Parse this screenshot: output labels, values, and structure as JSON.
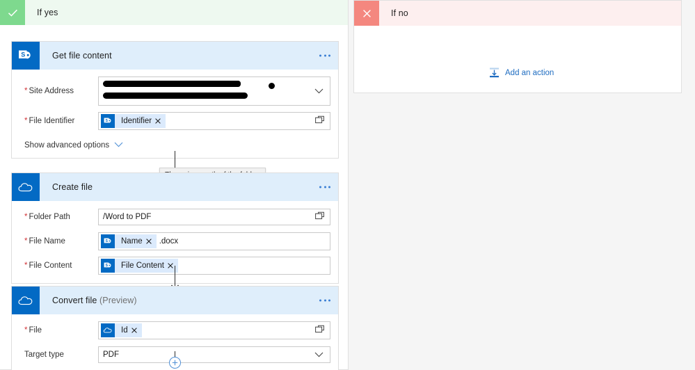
{
  "branches": {
    "yes": {
      "title": "If yes",
      "badge_icon": "checkmark-icon",
      "badge_color": "#7ed98e",
      "header_bg": "#eef9f0"
    },
    "no": {
      "title": "If no",
      "badge_icon": "close-x-icon",
      "badge_color": "#f4877f",
      "header_bg": "#fdefef",
      "add_action_label": "Add an action",
      "add_action_icon": "insert-action-icon"
    }
  },
  "tooltip": {
    "text": "The unique path of the folder."
  },
  "actions": [
    {
      "id": "get-file-content",
      "title": "Get file content",
      "preview_tag": "",
      "connector_icon": "sharepoint-icon",
      "menu_icon": "ellipsis-icon",
      "fields": [
        {
          "label": "Site Address",
          "required": true,
          "type": "combobox-redacted",
          "value": "",
          "trailing_icon": "chevron-down-icon"
        },
        {
          "label": "File Identifier",
          "required": true,
          "type": "token",
          "token_label": "Identifier",
          "token_icon": "sharepoint-icon",
          "token_remove_icon": "close-x-icon",
          "trailing_icon": "folder-picker-icon"
        }
      ],
      "advanced_label": "Show advanced options",
      "advanced_icon": "chevron-down-icon"
    },
    {
      "id": "create-file",
      "title": "Create file",
      "preview_tag": "",
      "connector_icon": "onedrive-icon",
      "menu_icon": "ellipsis-icon",
      "fields": [
        {
          "label": "Folder Path",
          "required": true,
          "type": "text",
          "value": "/Word to PDF",
          "trailing_icon": "folder-picker-icon"
        },
        {
          "label": "File Name",
          "required": true,
          "type": "token",
          "token_label": "Name",
          "token_icon": "sharepoint-icon",
          "token_remove_icon": "close-x-icon",
          "suffix": ".docx",
          "trailing_icon": ""
        },
        {
          "label": "File Content",
          "required": true,
          "type": "token",
          "token_label": "File Content",
          "token_icon": "sharepoint-icon",
          "token_remove_icon": "close-x-icon",
          "trailing_icon": ""
        }
      ]
    },
    {
      "id": "convert-file",
      "title": "Convert file",
      "preview_tag": "(Preview)",
      "connector_icon": "onedrive-icon",
      "menu_icon": "ellipsis-icon",
      "fields": [
        {
          "label": "File",
          "required": true,
          "type": "token",
          "token_label": "Id",
          "token_icon": "onedrive-icon",
          "token_remove_icon": "close-x-icon",
          "trailing_icon": "folder-picker-icon"
        },
        {
          "label": "Target type",
          "required": false,
          "type": "combobox",
          "value": "PDF",
          "trailing_icon": "chevron-down-icon"
        }
      ]
    }
  ],
  "add_step": {
    "icon": "plus-circle-icon"
  },
  "colors": {
    "accent_blue": "#036ac4",
    "card_header_bg": "#dfeefb",
    "token_chip_bg": "#dbeafc",
    "required_red": "#d13438",
    "link_blue": "#1e6cc1"
  }
}
